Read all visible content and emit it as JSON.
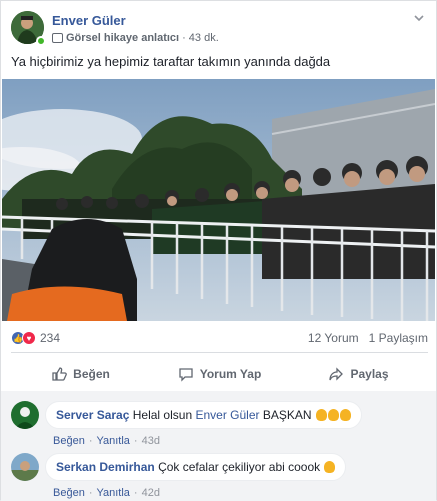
{
  "post": {
    "author": "Enver Güler",
    "role": "Görsel hikaye anlatıcı",
    "separator": "·",
    "time": "43 dk.",
    "text": "Ya hiçbirimiz ya hepimiz taraftar takımın yanında dağda"
  },
  "stats": {
    "reaction_count": "234",
    "comments": "12 Yorum",
    "shares": "1 Paylaşım"
  },
  "actions": {
    "like": "Beğen",
    "comment": "Yorum Yap",
    "share": "Paylaş"
  },
  "comments": [
    {
      "name": "Server Saraç",
      "text_before": "Helal olsun",
      "mention": "Enver Güler",
      "text_after": "BAŞKAN",
      "like_label": "Beğen",
      "reply_label": "Yanıtla",
      "time": "43d"
    },
    {
      "name": "Serkan Demirhan",
      "text_before": "Çok cefalar çekiliyor abi coook",
      "like_label": "Beğen",
      "reply_label": "Yanıtla",
      "time": "42d"
    }
  ],
  "colors": {
    "link": "#365899",
    "like_blue": "#4267b2",
    "love_red": "#f0284a",
    "online_green": "#42b72a"
  }
}
